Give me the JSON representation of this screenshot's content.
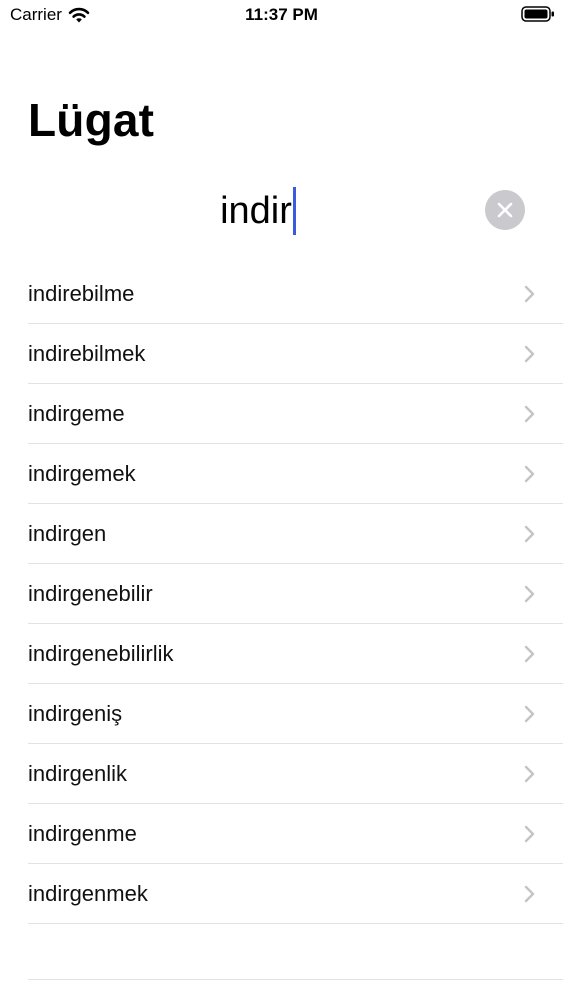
{
  "status_bar": {
    "carrier": "Carrier",
    "time": "11:37 PM"
  },
  "page": {
    "title": "Lügat"
  },
  "search": {
    "value": "indir",
    "clear_icon": "close-circle-icon"
  },
  "colors": {
    "caret": "#3b5bdb",
    "clear_button_bg": "#c9c9ce",
    "chevron": "#c4c4c7",
    "separator": "#e2e2e6"
  },
  "results": [
    {
      "label": "indirebilme"
    },
    {
      "label": "indirebilmek"
    },
    {
      "label": "indirgeme"
    },
    {
      "label": "indirgemek"
    },
    {
      "label": "indirgen"
    },
    {
      "label": "indirgenebilir"
    },
    {
      "label": "indirgenebilirlik"
    },
    {
      "label": "indirgeniş"
    },
    {
      "label": "indirgenlik"
    },
    {
      "label": "indirgenme"
    },
    {
      "label": "indirgenmek"
    }
  ]
}
